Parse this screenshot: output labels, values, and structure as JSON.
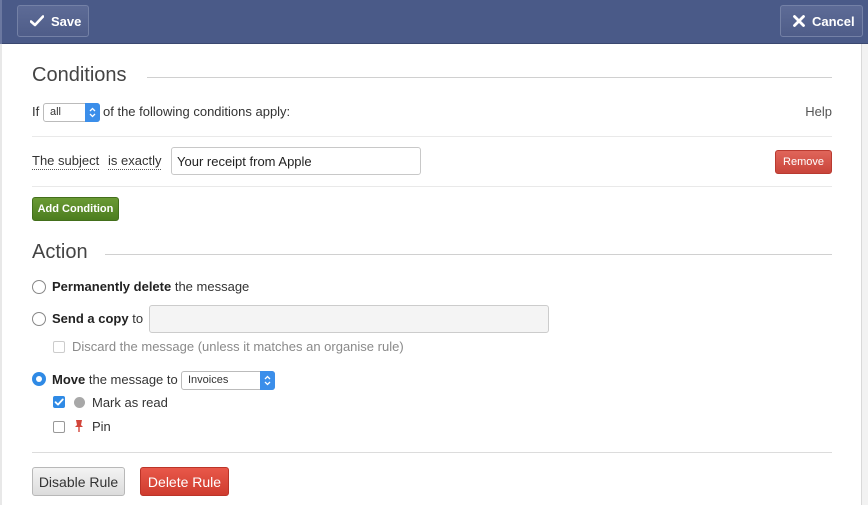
{
  "toolbar": {
    "save_label": "Save",
    "cancel_label": "Cancel"
  },
  "conditions": {
    "title": "Conditions",
    "if_label": "If",
    "match_select": "all",
    "suffix": "of the following conditions apply:",
    "help_label": "Help",
    "rule": {
      "field": "The subject",
      "operator": "is exactly",
      "value": "Your receipt from Apple",
      "remove_label": "Remove"
    },
    "add_label": "Add Condition"
  },
  "action": {
    "title": "Action",
    "delete_bold": "Permanently delete",
    "delete_rest": "the message",
    "copy_bold": "Send a copy",
    "copy_rest": "to",
    "copy_value": "",
    "discard_label": "Discard the message (unless it matches an organise rule)",
    "move_bold": "Move",
    "move_rest": "the message to",
    "move_folder": "Invoices",
    "mark_read_label": "Mark as read",
    "pin_label": "Pin",
    "selected": "move",
    "mark_read_checked": true,
    "pin_checked": false
  },
  "footer": {
    "disable_label": "Disable Rule",
    "delete_label": "Delete Rule"
  },
  "colors": {
    "toolbar": "#4a5a88",
    "accent_blue": "#2f8ae5",
    "remove_red": "#c9453b",
    "add_green": "#4c7d1f"
  }
}
